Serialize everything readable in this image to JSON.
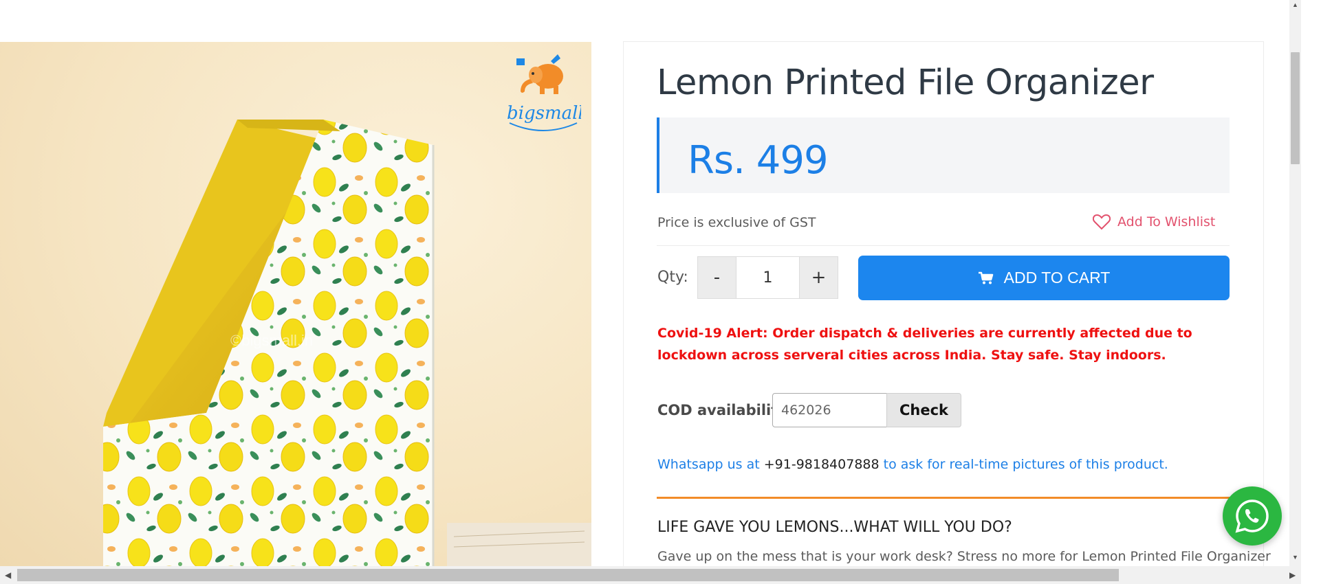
{
  "product": {
    "title": "Lemon Printed File Organizer",
    "price": "Rs. 499",
    "gst_note": "Price is exclusive of GST",
    "wishlist_label": "Add To Wishlist",
    "image_watermark": "©bigsmall.in"
  },
  "brand": {
    "logo_text": "bigsmallin",
    "colors": {
      "blue": "#1e88e5",
      "orange": "#f28c28"
    }
  },
  "quantity": {
    "label": "Qty:",
    "decrement": "-",
    "value": "1",
    "increment": "+"
  },
  "cart": {
    "label": "ADD TO CART",
    "icon": "cart-icon",
    "color": "#1c86ee"
  },
  "alert": {
    "text": "Covid-19 Alert: Order dispatch & deliveries are currently affected due to lockdown across serveral cities across India. Stay safe. Stay indoors.",
    "color": "#ee1111"
  },
  "cod": {
    "label": "COD availability",
    "pincode_value": "462026",
    "check_label": "Check"
  },
  "whatsapp": {
    "prefix": "Whatsapp us at",
    "phone": "+91-9818407888",
    "suffix": "to ask for real-time pictures of this product.",
    "float_icon": "whatsapp-icon"
  },
  "description": {
    "heading": "LIFE GAVE YOU LEMONS...WHAT WILL YOU DO?",
    "text": "Gave up on the mess that is your work desk? Stress no more for Lemon Printed File Organizer"
  },
  "colors": {
    "title": "#2f3a45",
    "price": "#1c7fe6",
    "wishlist": "#e2516d",
    "divider_accent": "#f28c28",
    "whatsapp_green": "#2bb741"
  }
}
